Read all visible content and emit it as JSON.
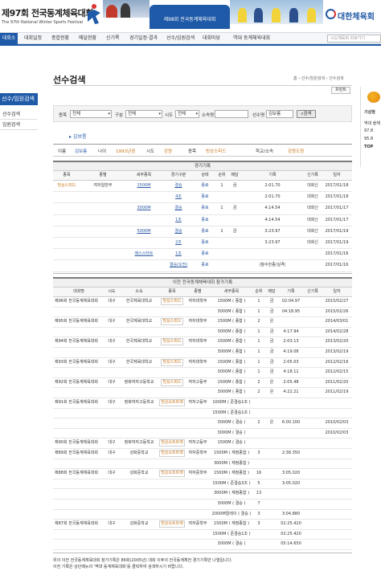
{
  "banner": {
    "title": "제97회 전국동계체육대회",
    "subtitle": "The 97th National Winter Sports Festival",
    "center_label": "제98회 전국동계체육대회",
    "org_name": "대한체육회"
  },
  "nav": {
    "home": "대회소개",
    "items": [
      "대회일정",
      "종합현황",
      "메달현황",
      "신기록",
      "경기일정·결과",
      "선수/임원검색",
      "대회마당",
      "역대 동계체육대회"
    ],
    "search_placeholder": "시도체육회 바로가기"
  },
  "sidebar": {
    "title": "선수/임원검색",
    "items": [
      "선수검색",
      "임원검색"
    ]
  },
  "page": {
    "title": "선수검색",
    "breadcrumb": "홈 › 선수/임원검색 › 선수검색",
    "print": "프린트"
  },
  "search": {
    "event_label": "종목",
    "event_value": "전체",
    "division_label": "구분",
    "division_value": "전체",
    "city_label": "시도",
    "city_value": "전체",
    "school_label": "소속명",
    "school_value": "",
    "name_label": "선수명",
    "name_value": "김보름",
    "button": "검색"
  },
  "athlete": {
    "name_link": "김보름",
    "name_label": "이름",
    "name": "김보름",
    "age_label": "나이",
    "age": "1993년생",
    "city_label": "시도",
    "city": "강원",
    "event_label": "종목",
    "event": "빙상스피드",
    "school_label": "학교/소속",
    "school": "강원도청"
  },
  "current": {
    "title": "경기기록",
    "headers": [
      "종목",
      "종별",
      "세부종목",
      "경기구분",
      "상태",
      "순위",
      "메달",
      "기록",
      "신기록",
      "일자"
    ],
    "rows": [
      {
        "event": "빙상스피드",
        "class": "여자일반부",
        "detail": "1500M",
        "round": "결승",
        "status": "종료",
        "rank": "1",
        "medal": "금",
        "record": "2:01.70",
        "new": "대회신",
        "date": "2017/01/18"
      },
      {
        "event": "",
        "class": "",
        "detail": "",
        "round": "4조",
        "status": "종료",
        "rank": "",
        "medal": "",
        "record": "2:01.70",
        "new": "대회신",
        "date": "2017/01/18"
      },
      {
        "event": "",
        "class": "",
        "detail": "3000M",
        "round": "결승",
        "status": "종료",
        "rank": "1",
        "medal": "금",
        "record": "4:14.54",
        "new": "대회신",
        "date": "2017/01/17"
      },
      {
        "event": "",
        "class": "",
        "detail": "",
        "round": "1조",
        "status": "종료",
        "rank": "",
        "medal": "",
        "record": "4:14.54",
        "new": "대회신",
        "date": "2017/01/17"
      },
      {
        "event": "",
        "class": "",
        "detail": "5000M",
        "round": "결승",
        "status": "종료",
        "rank": "1",
        "medal": "금",
        "record": "3:23.97",
        "new": "대회신",
        "date": "2017/01/19"
      },
      {
        "event": "",
        "class": "",
        "detail": "",
        "round": "2조",
        "status": "종료",
        "rank": "",
        "medal": "",
        "record": "3:23.97",
        "new": "대회신",
        "date": "2017/01/19"
      },
      {
        "event": "",
        "class": "",
        "detail": "매스스타트",
        "round": "1조",
        "status": "종료",
        "rank": "",
        "medal": "",
        "record": "",
        "new": "",
        "date": "2017/01/16"
      },
      {
        "event": "",
        "class": "",
        "detail": "",
        "round": "결승(오전)",
        "status": "종료",
        "rank": "",
        "medal": "",
        "record": "(참수안종/실격)",
        "new": "",
        "date": "2017/01/16"
      }
    ]
  },
  "history": {
    "title": "이전 전국동계체육대회 참가기록",
    "headers": [
      "대회명",
      "시도",
      "소속",
      "종목",
      "종별",
      "세부종목",
      "순위",
      "메달",
      "기록",
      "신기록",
      "일자"
    ],
    "rows": [
      {
        "meet": "제96회 전국동계체육대회",
        "city": "대구",
        "school": "한국체육대학교",
        "event": "빙상스피드",
        "class": "여자대학부",
        "detail": "1500M ( 종합 )",
        "rank": "1",
        "medal": "금",
        "record": "02:04.97",
        "new": "",
        "date": "2015/02/27"
      },
      {
        "meet": "",
        "city": "",
        "school": "",
        "event": "",
        "class": "",
        "detail": "3000M ( 종합 )",
        "rank": "1",
        "medal": "금",
        "record": "04:18.95",
        "new": "",
        "date": "2015/02/26"
      },
      {
        "meet": "제95회 전국동계체육대회",
        "city": "대구",
        "school": "한국체육대학교",
        "event": "빙상스피드",
        "class": "여자대학부",
        "detail": "1500M ( 종합 )",
        "rank": "2",
        "medal": "은",
        "record": "",
        "new": "",
        "date": "2014/03/01"
      },
      {
        "meet": "",
        "city": "",
        "school": "",
        "event": "",
        "class": "",
        "detail": "3000M ( 종합 )",
        "rank": "1",
        "medal": "금",
        "record": "4:17.94",
        "new": "",
        "date": "2014/02/28"
      },
      {
        "meet": "제94회 전국동계체육대회",
        "city": "대구",
        "school": "한국체육대학교",
        "event": "빙상스피드",
        "class": "여자대학부",
        "detail": "1500M ( 종합 )",
        "rank": "1",
        "medal": "금",
        "record": "2:03.13",
        "new": "",
        "date": "2013/02/20"
      },
      {
        "meet": "",
        "city": "",
        "school": "",
        "event": "",
        "class": "",
        "detail": "3000M ( 종합 )",
        "rank": "1",
        "medal": "금",
        "record": "4:19.08",
        "new": "",
        "date": "2013/02/19"
      },
      {
        "meet": "제93회 전국동계체육대회",
        "city": "대구",
        "school": "한국체육대학교",
        "event": "빙상스피드",
        "class": "여자대학부",
        "detail": "1500M ( 종합 )",
        "rank": "1",
        "medal": "금",
        "record": "2:05.03",
        "new": "",
        "date": "2012/02/16"
      },
      {
        "meet": "",
        "city": "",
        "school": "",
        "event": "",
        "class": "",
        "detail": "3000M ( 종합 )",
        "rank": "1",
        "medal": "금",
        "record": "4:18.11",
        "new": "",
        "date": "2012/02/15"
      },
      {
        "meet": "제92회 전국동계체육대회",
        "city": "대구",
        "school": "정화여자고등학교",
        "event": "빙상스피드",
        "class": "여자고등부",
        "detail": "1500M ( 종합 )",
        "rank": "2",
        "medal": "은",
        "record": "2:05.48",
        "new": "",
        "date": "2011/02/20"
      },
      {
        "meet": "",
        "city": "",
        "school": "",
        "event": "",
        "class": "",
        "detail": "3000M ( 종합 )",
        "rank": "2",
        "medal": "은",
        "record": "4:22.21",
        "new": "",
        "date": "2011/02/19"
      },
      {
        "meet": "제91회 전국동계체육대회",
        "city": "대구",
        "school": "정화여자고등학교",
        "event": "빙상쇼트트랙",
        "class": "여자고등부",
        "detail": "1000M ( 준결승1조 )",
        "rank": "",
        "medal": "",
        "record": "",
        "new": "",
        "date": ""
      },
      {
        "meet": "",
        "city": "",
        "school": "",
        "event": "",
        "class": "",
        "detail": "1500M ( 준결승1조 )",
        "rank": "",
        "medal": "",
        "record": "",
        "new": "",
        "date": ""
      },
      {
        "meet": "",
        "city": "",
        "school": "",
        "event": "",
        "class": "",
        "detail": "3000M ( 결승 )",
        "rank": "2",
        "medal": "은",
        "record": "6:00.100",
        "new": "",
        "date": "2010/02/03"
      },
      {
        "meet": "",
        "city": "",
        "school": "",
        "event": "",
        "class": "",
        "detail": "3000M ( 결승 )",
        "rank": "",
        "medal": "",
        "record": "",
        "new": "",
        "date": "2010/02/03"
      },
      {
        "meet": "제90회 전국동계체육대회",
        "city": "대구",
        "school": "정화여자고등학교",
        "event": "빙상쇼트트랙",
        "class": "여자고등부",
        "detail": "1500M ( 결승 )",
        "rank": "",
        "medal": "",
        "record": "",
        "new": "",
        "date": ""
      },
      {
        "meet": "제89회 전국동계체육대회",
        "city": "대구",
        "school": "성화중학교",
        "event": "빙상쇼트트랙",
        "class": "여자중학부",
        "detail": "1500M ( 재정종합 )",
        "rank": "3",
        "medal": "",
        "record": "2:38.350",
        "new": "",
        "date": ""
      },
      {
        "meet": "",
        "city": "",
        "school": "",
        "event": "",
        "class": "",
        "detail": "3000M ( 재정종합 )",
        "rank": "",
        "medal": "",
        "record": "",
        "new": "",
        "date": ""
      },
      {
        "meet": "제88회 전국동계체육대회",
        "city": "대구",
        "school": "성화중학교",
        "event": "빙상쇼트트랙",
        "class": "여자중학부",
        "detail": "1500M ( 재정종합 )",
        "rank": "16",
        "medal": "",
        "record": "3:05.020",
        "new": "",
        "date": ""
      },
      {
        "meet": "",
        "city": "",
        "school": "",
        "event": "",
        "class": "",
        "detail": "1500M ( 준결승3조 )",
        "rank": "5",
        "medal": "",
        "record": "3:05.020",
        "new": "",
        "date": ""
      },
      {
        "meet": "",
        "city": "",
        "school": "",
        "event": "",
        "class": "",
        "detail": "3000M ( 재정종합 )",
        "rank": "13",
        "medal": "",
        "record": "",
        "new": "",
        "date": ""
      },
      {
        "meet": "",
        "city": "",
        "school": "",
        "event": "",
        "class": "",
        "detail": "3000M ( 결승 )",
        "rank": "7",
        "medal": "",
        "record": "",
        "new": "",
        "date": ""
      },
      {
        "meet": "",
        "city": "",
        "school": "",
        "event": "",
        "class": "",
        "detail": "2000M릴레이 ( 결승 )",
        "rank": "3",
        "medal": "",
        "record": "3:04.880",
        "new": "",
        "date": ""
      },
      {
        "meet": "제87회 전국동계체육대회",
        "city": "대구",
        "school": "성화중학교",
        "event": "빙상쇼트트랙",
        "class": "여자중학부",
        "detail": "1500M ( 재정종합 )",
        "rank": "3",
        "medal": "",
        "record": "02:25.420",
        "new": "",
        "date": ""
      },
      {
        "meet": "",
        "city": "",
        "school": "",
        "event": "",
        "class": "",
        "detail": "1500M ( 준결승1조 )",
        "rank": "",
        "medal": "",
        "record": "02:25.420",
        "new": "",
        "date": ""
      },
      {
        "meet": "",
        "city": "",
        "school": "",
        "event": "",
        "class": "",
        "detail": "3000M ( 결승 )",
        "rank": "",
        "medal": "",
        "record": "05:14.650",
        "new": "",
        "date": ""
      }
    ]
  },
  "footer": {
    "line1": "위의 이전 전국동계체육대회 참가기록은 86회(2005년) 대회 이후의 전국동계체전 경기기록만 나열됩니다.",
    "line2": "이전 기록은 상단메뉴의 '역대 동계체육대회'를 클릭하여 검색하시기 바랍니다."
  },
  "right_ad": {
    "title": "기상청",
    "lines": [
      "역대 올해",
      "97.8",
      "95.8",
      "TOP"
    ]
  }
}
